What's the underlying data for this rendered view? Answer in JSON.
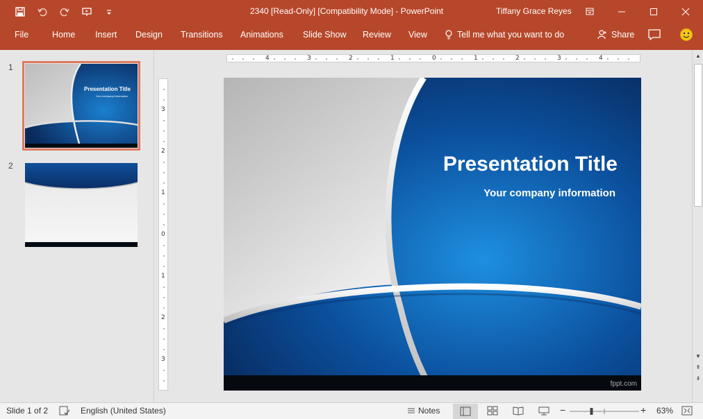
{
  "window": {
    "title": "2340 [Read-Only] [Compatibility Mode]  -  PowerPoint",
    "user": "Tiffany Grace Reyes",
    "colors": {
      "accent": "#b7472a",
      "selection": "#e07a5f"
    }
  },
  "qat": {
    "items": [
      "save-icon",
      "undo-icon",
      "redo-icon",
      "present-icon",
      "customize-qat-icon"
    ]
  },
  "ribbon": {
    "tabs": [
      "File",
      "Home",
      "Insert",
      "Design",
      "Transitions",
      "Animations",
      "Slide Show",
      "Review",
      "View"
    ],
    "tell_me": "Tell me what you want to do",
    "share": "Share"
  },
  "thumbnails": {
    "items": [
      {
        "number": "1",
        "title": "Presentation Title",
        "subtitle": "Your company information",
        "selected": true
      },
      {
        "number": "2",
        "selected": false
      }
    ]
  },
  "rulers": {
    "horizontal": [
      "4",
      "3",
      "2",
      "1",
      "0",
      "1",
      "2",
      "3",
      "4"
    ],
    "vertical": [
      "3",
      "2",
      "1",
      "0",
      "1",
      "2",
      "3"
    ]
  },
  "slide": {
    "title": "Presentation Title",
    "subtitle": "Your company information",
    "footer": "fppt.com"
  },
  "status": {
    "slide_info": "Slide 1 of 2",
    "language": "English (United States)",
    "notes": "Notes",
    "zoom": "63%",
    "zoom_level": 0.63
  }
}
